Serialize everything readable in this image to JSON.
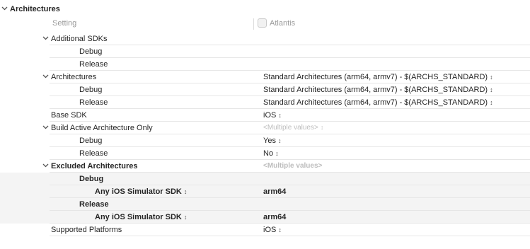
{
  "section": {
    "title": "Architectures"
  },
  "columns": {
    "setting": "Setting",
    "target": "Atlantis"
  },
  "icons": {
    "expand": "chevron-down-icon",
    "stepper": "up-down-arrows-icon",
    "target": "app-target-icon"
  },
  "rows": {
    "additional_sdks": {
      "name": "Additional SDKs"
    },
    "additional_sdks_debug": {
      "name": "Debug"
    },
    "additional_sdks_release": {
      "name": "Release"
    },
    "architectures": {
      "name": "Architectures",
      "value": "Standard Architectures (arm64, armv7)  -  $(ARCHS_STANDARD)"
    },
    "architectures_debug": {
      "name": "Debug",
      "value": "Standard Architectures (arm64, armv7)  -  $(ARCHS_STANDARD)"
    },
    "architectures_release": {
      "name": "Release",
      "value": "Standard Architectures (arm64, armv7)  -  $(ARCHS_STANDARD)"
    },
    "base_sdk": {
      "name": "Base SDK",
      "value": "iOS"
    },
    "build_active": {
      "name": "Build Active Architecture Only",
      "value": "<Multiple values>"
    },
    "build_active_debug": {
      "name": "Debug",
      "value": "Yes"
    },
    "build_active_release": {
      "name": "Release",
      "value": "No"
    },
    "excluded": {
      "name": "Excluded Architectures",
      "value": "<Multiple values>"
    },
    "excluded_debug": {
      "name": "Debug"
    },
    "excluded_debug_sdk": {
      "name": "Any iOS Simulator SDK",
      "value": "arm64"
    },
    "excluded_release": {
      "name": "Release"
    },
    "excluded_release_sdk": {
      "name": "Any iOS Simulator SDK",
      "value": "arm64"
    },
    "supported_platforms": {
      "name": "Supported Platforms",
      "value": "iOS"
    }
  },
  "stepper_glyph": "↕"
}
